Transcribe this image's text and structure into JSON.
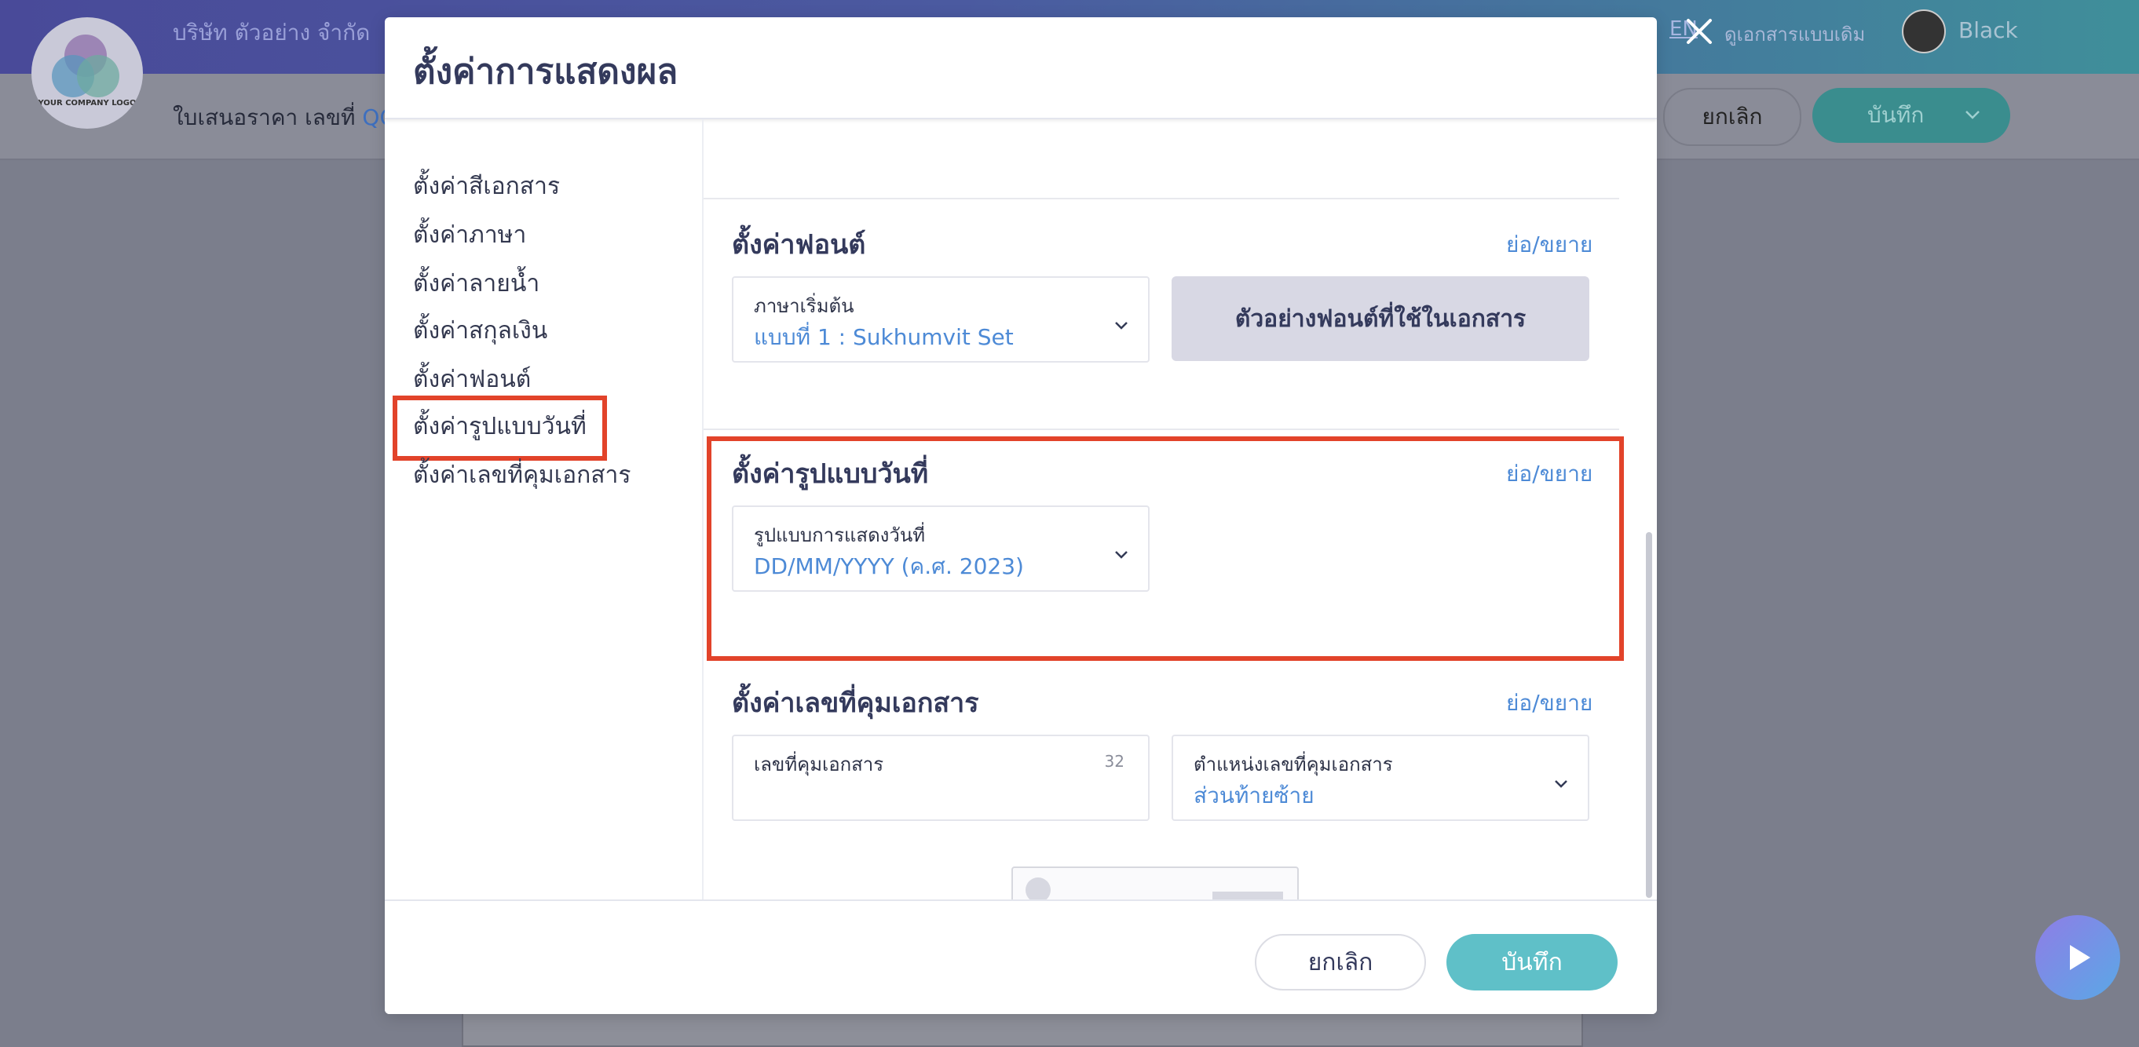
{
  "app": {
    "company_name": "บริษัท ตัวอย่าง จำกัด",
    "logo_text": "YOUR COMPANY LOGO",
    "doc_label": "ใบเสนอราคา เลขที่",
    "doc_no": "QO-",
    "lang_link": "EN",
    "old_doc_link": "ดูเอกสารแบบเดิม",
    "user_name": "Black",
    "cancel_label": "ยกเลิก",
    "save_label": "บันทึก"
  },
  "modal": {
    "title": "ตั้งค่าการแสดงผล",
    "sidebar": [
      {
        "label": "ตั้งค่าสีเอกสาร"
      },
      {
        "label": "ตั้งค่าภาษา"
      },
      {
        "label": "ตั้งค่าลายน้ำ"
      },
      {
        "label": "ตั้งค่าสกุลเงิน"
      },
      {
        "label": "ตั้งค่าฟอนต์"
      },
      {
        "label": "ตั้งค่ารูปแบบวันที่"
      },
      {
        "label": "ตั้งค่าเลขที่คุมเอกสาร"
      }
    ],
    "font_section": {
      "title": "ตั้งค่าฟอนต์",
      "toggle": "ย่อ/ขยาย",
      "field_label": "ภาษาเริ่มต้น",
      "field_value": "แบบที่ 1 : Sukhumvit Set",
      "preview_button": "ตัวอย่างฟอนต์ที่ใช้ในเอกสาร"
    },
    "date_section": {
      "title": "ตั้งค่ารูปแบบวันที่",
      "toggle": "ย่อ/ขยาย",
      "field_label": "รูปแบบการแสดงวันที่",
      "field_value": "DD/MM/YYYY (ค.ศ. 2023)"
    },
    "control_section": {
      "title": "ตั้งค่าเลขที่คุมเอกสาร",
      "toggle": "ย่อ/ขยาย",
      "number_label": "เลขที่คุมเอกสาร",
      "number_counter": "32",
      "number_value": "",
      "position_label": "ตำแหน่งเลขที่คุมเอกสาร",
      "position_value": "ส่วนท้ายซ้าย"
    },
    "footer": {
      "cancel": "ยกเลิก",
      "save": "บันทึก"
    }
  },
  "colors": {
    "accent": "#4d8ad6",
    "save": "#5fc0c8",
    "highlight": "#e2432a"
  },
  "icons": [
    "close-icon",
    "chevron-down-icon",
    "play-icon"
  ]
}
